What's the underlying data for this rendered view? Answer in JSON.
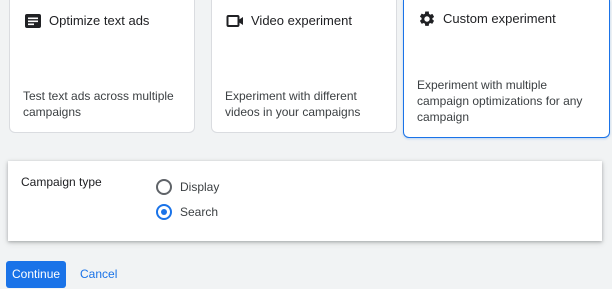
{
  "cards": [
    {
      "title": "Optimize text ads",
      "description": "Test text ads across multiple campaigns",
      "icon": "text-ad-icon"
    },
    {
      "title": "Video experiment",
      "description": "Experiment with different videos in your campaigns",
      "icon": "video-camera-icon"
    },
    {
      "title": "Custom experiment",
      "description": "Experiment with multiple campaign optimizations for any campaign",
      "icon": "gear-icon",
      "selected": true
    }
  ],
  "campaign_type": {
    "label": "Campaign type",
    "options": [
      {
        "label": "Display",
        "selected": false
      },
      {
        "label": "Search",
        "selected": true
      }
    ]
  },
  "actions": {
    "continue_label": "Continue",
    "cancel_label": "Cancel"
  },
  "colors": {
    "accent": "#1a73e8",
    "background": "#f1f3f4"
  }
}
